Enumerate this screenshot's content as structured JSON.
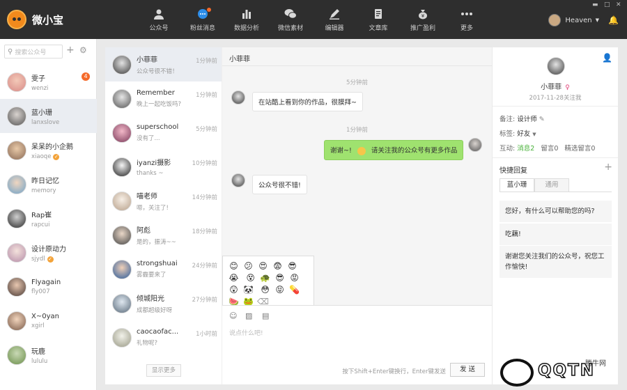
{
  "app": {
    "name": "微小宝"
  },
  "nav": [
    {
      "label": "公众号",
      "icon": "user-icon",
      "dot": false
    },
    {
      "label": "粉丝消息",
      "icon": "chat-bubble-icon",
      "dot": true
    },
    {
      "label": "数据分析",
      "icon": "bar-chart-icon",
      "dot": false
    },
    {
      "label": "微信素材",
      "icon": "wechat-icon",
      "dot": false
    },
    {
      "label": "编辑器",
      "icon": "pen-icon",
      "dot": false
    },
    {
      "label": "文章库",
      "icon": "document-icon",
      "dot": false
    },
    {
      "label": "推广盈利",
      "icon": "money-bag-icon",
      "dot": false
    },
    {
      "label": "更多",
      "icon": "more-dots-icon",
      "dot": false
    }
  ],
  "user": {
    "name": "Heaven"
  },
  "window": {
    "min": "▬",
    "max": "□",
    "close": "✕"
  },
  "search": {
    "placeholder": "搜索公众号"
  },
  "accounts": [
    {
      "name": "雯子",
      "handle": "wenzi",
      "count": "4",
      "verified": false
    },
    {
      "name": "蓝小珊",
      "handle": "lanxslove",
      "verified": false,
      "active": true
    },
    {
      "name": "呆呆的小企鹅",
      "handle": "xiaoqe",
      "verified": true
    },
    {
      "name": "昨日记忆",
      "handle": "memory",
      "verified": false
    },
    {
      "name": "Rap崔",
      "handle": "rapcui",
      "verified": false
    },
    {
      "name": "设计原动力",
      "handle": "sjydl",
      "verified": true
    },
    {
      "name": "Flyagain",
      "handle": "fly007",
      "verified": false
    },
    {
      "name": "X~0yan",
      "handle": "xgirl",
      "verified": false
    },
    {
      "name": "玩鹿",
      "handle": "lululu",
      "verified": false
    }
  ],
  "messages": [
    {
      "name": "小菲菲",
      "preview": "公众号很不错！",
      "time": "1分钟前"
    },
    {
      "name": "Remember",
      "preview": "晚上一起吃饭吗?",
      "time": "1分钟前"
    },
    {
      "name": "superschool",
      "preview": "没有了...",
      "time": "5分钟前"
    },
    {
      "name": "iyanzi摄影",
      "preview": "thanks ~",
      "time": "10分钟前"
    },
    {
      "name": "喵老师",
      "preview": "嗯，关注了!",
      "time": "14分钟前"
    },
    {
      "name": "阿彪",
      "preview": "是的，振涛~~",
      "time": "18分钟前"
    },
    {
      "name": "strongshuai",
      "preview": "雾霾要来了",
      "time": "24分钟前"
    },
    {
      "name": "倾城阳光",
      "preview": "成都超级好呀",
      "time": "27分钟前"
    },
    {
      "name": "caocaofac...",
      "preview": "礼物呢?",
      "time": "1小时前"
    }
  ],
  "messages_more": "显示更多",
  "chat": {
    "title": "小菲菲",
    "time1": "5分钟前",
    "msg1": "在站酷上看到你的作品，很膜拜~",
    "time2": "1分钟前",
    "msg2_a": "谢谢~!",
    "msg2_b": "请关注我的公众号有更多作品",
    "msg3": "公众号很不错!",
    "placeholder": "说点什么吧!",
    "hint": "按下Shift+Enter键换行，Enter键发送",
    "send": "发 送"
  },
  "emojis": [
    "😊",
    "😕",
    "😍",
    "😨",
    "😎",
    "😭",
    "😵",
    "🐢",
    "😎",
    "😡",
    "😲",
    "🐼",
    "😳",
    "😝",
    "💊",
    "🍉",
    "🐸",
    "⌫"
  ],
  "profile": {
    "name": "小菲菲",
    "followed": "2017-11-28关注我",
    "note_label": "备注:",
    "note_value": "设计师",
    "tag_label": "标签:",
    "tag_value": "好友",
    "interact_label": "互动:",
    "interact_msg": "消息2",
    "interact_comment": "留言0",
    "interact_pick": "精选留言0"
  },
  "quick_reply": {
    "title": "快捷回复",
    "tabs": [
      "蓝小珊",
      "通用"
    ],
    "items": [
      "您好，有什么可以帮助您的吗?",
      "吃藕!",
      "谢谢您关注我们的公众号，祝您工作愉快!"
    ]
  },
  "watermark": {
    "text": "QQTN",
    "sub": "腾牛网"
  },
  "colors": {
    "topbar": "#2e2e2e",
    "accent": "#f56a2a",
    "bubble_green": "#9fe26f",
    "active_row": "#eaedf2"
  }
}
